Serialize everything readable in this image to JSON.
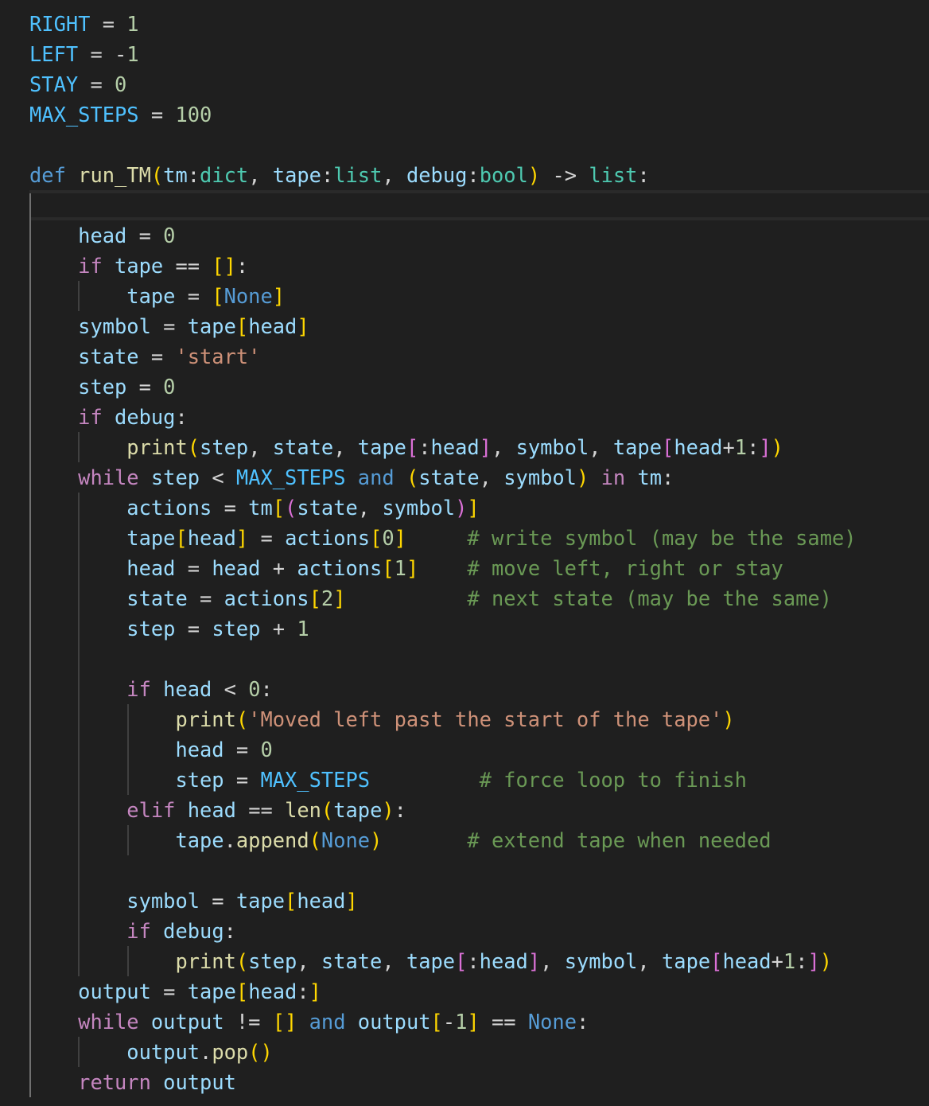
{
  "editor": {
    "language": "python",
    "theme_colors": {
      "background": "#1f1f1f",
      "keyword_control": "#c586c0",
      "keyword": "#569cd6",
      "constant": "#4fc1ff",
      "variable": "#9cdcfe",
      "function": "#dcdcaa",
      "type": "#4ec9b0",
      "number": "#b5cea8",
      "string": "#ce9178",
      "comment": "#6a9955",
      "bracket_level_1": "#ffd700",
      "bracket_level_2": "#da70d6"
    },
    "current_line": 6,
    "lines": [
      {
        "indent": 0,
        "tokens": [
          [
            "const",
            "RIGHT"
          ],
          [
            "op",
            " = "
          ],
          [
            "num",
            "1"
          ]
        ]
      },
      {
        "indent": 0,
        "tokens": [
          [
            "const",
            "LEFT"
          ],
          [
            "op",
            " = -"
          ],
          [
            "num",
            "1"
          ]
        ]
      },
      {
        "indent": 0,
        "tokens": [
          [
            "const",
            "STAY"
          ],
          [
            "op",
            " = "
          ],
          [
            "num",
            "0"
          ]
        ]
      },
      {
        "indent": 0,
        "tokens": [
          [
            "const",
            "MAX_STEPS"
          ],
          [
            "op",
            " = "
          ],
          [
            "num",
            "100"
          ]
        ]
      },
      {
        "indent": 0,
        "tokens": []
      },
      {
        "indent": 0,
        "tokens": [
          [
            "kw",
            "def"
          ],
          [
            "op",
            " "
          ],
          [
            "fn",
            "run_TM"
          ],
          [
            "b1",
            "("
          ],
          [
            "var",
            "tm"
          ],
          [
            "op",
            ":"
          ],
          [
            "type",
            "dict"
          ],
          [
            "op",
            ", "
          ],
          [
            "var",
            "tape"
          ],
          [
            "op",
            ":"
          ],
          [
            "type",
            "list"
          ],
          [
            "op",
            ", "
          ],
          [
            "var",
            "debug"
          ],
          [
            "op",
            ":"
          ],
          [
            "type",
            "bool"
          ],
          [
            "b1",
            ")"
          ],
          [
            "op",
            " -> "
          ],
          [
            "type",
            "list"
          ],
          [
            "op",
            ":"
          ]
        ]
      },
      {
        "indent": 1,
        "tokens": [],
        "current": true
      },
      {
        "indent": 1,
        "tokens": [
          [
            "var",
            "head"
          ],
          [
            "op",
            " = "
          ],
          [
            "num",
            "0"
          ]
        ]
      },
      {
        "indent": 1,
        "tokens": [
          [
            "kw-ctrl",
            "if"
          ],
          [
            "op",
            " "
          ],
          [
            "var",
            "tape"
          ],
          [
            "op",
            " == "
          ],
          [
            "b1",
            "[]"
          ],
          [
            "op",
            ":"
          ]
        ]
      },
      {
        "indent": 2,
        "tokens": [
          [
            "var",
            "tape"
          ],
          [
            "op",
            " = "
          ],
          [
            "b1",
            "["
          ],
          [
            "kw",
            "None"
          ],
          [
            "b1",
            "]"
          ]
        ]
      },
      {
        "indent": 1,
        "tokens": [
          [
            "var",
            "symbol"
          ],
          [
            "op",
            " = "
          ],
          [
            "var",
            "tape"
          ],
          [
            "b1",
            "["
          ],
          [
            "var",
            "head"
          ],
          [
            "b1",
            "]"
          ]
        ]
      },
      {
        "indent": 1,
        "tokens": [
          [
            "var",
            "state"
          ],
          [
            "op",
            " = "
          ],
          [
            "str",
            "'start'"
          ]
        ]
      },
      {
        "indent": 1,
        "tokens": [
          [
            "var",
            "step"
          ],
          [
            "op",
            " = "
          ],
          [
            "num",
            "0"
          ]
        ]
      },
      {
        "indent": 1,
        "tokens": [
          [
            "kw-ctrl",
            "if"
          ],
          [
            "op",
            " "
          ],
          [
            "var",
            "debug"
          ],
          [
            "op",
            ":"
          ]
        ]
      },
      {
        "indent": 2,
        "tokens": [
          [
            "fn",
            "print"
          ],
          [
            "b1",
            "("
          ],
          [
            "var",
            "step"
          ],
          [
            "op",
            ", "
          ],
          [
            "var",
            "state"
          ],
          [
            "op",
            ", "
          ],
          [
            "var",
            "tape"
          ],
          [
            "b2",
            "["
          ],
          [
            "op",
            ":"
          ],
          [
            "var",
            "head"
          ],
          [
            "b2",
            "]"
          ],
          [
            "op",
            ", "
          ],
          [
            "var",
            "symbol"
          ],
          [
            "op",
            ", "
          ],
          [
            "var",
            "tape"
          ],
          [
            "b2",
            "["
          ],
          [
            "var",
            "head"
          ],
          [
            "op",
            "+"
          ],
          [
            "num",
            "1"
          ],
          [
            "op",
            ":"
          ],
          [
            "b2",
            "]"
          ],
          [
            "b1",
            ")"
          ]
        ]
      },
      {
        "indent": 1,
        "tokens": [
          [
            "kw-ctrl",
            "while"
          ],
          [
            "op",
            " "
          ],
          [
            "var",
            "step"
          ],
          [
            "op",
            " < "
          ],
          [
            "const",
            "MAX_STEPS"
          ],
          [
            "op",
            " "
          ],
          [
            "kw",
            "and"
          ],
          [
            "op",
            " "
          ],
          [
            "b1",
            "("
          ],
          [
            "var",
            "state"
          ],
          [
            "op",
            ", "
          ],
          [
            "var",
            "symbol"
          ],
          [
            "b1",
            ")"
          ],
          [
            "op",
            " "
          ],
          [
            "kw-ctrl",
            "in"
          ],
          [
            "op",
            " "
          ],
          [
            "var",
            "tm"
          ],
          [
            "op",
            ":"
          ]
        ]
      },
      {
        "indent": 2,
        "tokens": [
          [
            "var",
            "actions"
          ],
          [
            "op",
            " = "
          ],
          [
            "var",
            "tm"
          ],
          [
            "b1",
            "["
          ],
          [
            "b2",
            "("
          ],
          [
            "var",
            "state"
          ],
          [
            "op",
            ", "
          ],
          [
            "var",
            "symbol"
          ],
          [
            "b2",
            ")"
          ],
          [
            "b1",
            "]"
          ]
        ]
      },
      {
        "indent": 2,
        "tokens": [
          [
            "var",
            "tape"
          ],
          [
            "b1",
            "["
          ],
          [
            "var",
            "head"
          ],
          [
            "b1",
            "]"
          ],
          [
            "op",
            " = "
          ],
          [
            "var",
            "actions"
          ],
          [
            "b1",
            "["
          ],
          [
            "num",
            "0"
          ],
          [
            "b1",
            "]"
          ],
          [
            "op",
            "     "
          ],
          [
            "cmt",
            "# write symbol (may be the same)"
          ]
        ]
      },
      {
        "indent": 2,
        "tokens": [
          [
            "var",
            "head"
          ],
          [
            "op",
            " = "
          ],
          [
            "var",
            "head"
          ],
          [
            "op",
            " + "
          ],
          [
            "var",
            "actions"
          ],
          [
            "b1",
            "["
          ],
          [
            "num",
            "1"
          ],
          [
            "b1",
            "]"
          ],
          [
            "op",
            "    "
          ],
          [
            "cmt",
            "# move left, right or stay"
          ]
        ]
      },
      {
        "indent": 2,
        "tokens": [
          [
            "var",
            "state"
          ],
          [
            "op",
            " = "
          ],
          [
            "var",
            "actions"
          ],
          [
            "b1",
            "["
          ],
          [
            "num",
            "2"
          ],
          [
            "b1",
            "]"
          ],
          [
            "op",
            "          "
          ],
          [
            "cmt",
            "# next state (may be the same)"
          ]
        ]
      },
      {
        "indent": 2,
        "tokens": [
          [
            "var",
            "step"
          ],
          [
            "op",
            " = "
          ],
          [
            "var",
            "step"
          ],
          [
            "op",
            " + "
          ],
          [
            "num",
            "1"
          ]
        ]
      },
      {
        "indent": 2,
        "tokens": []
      },
      {
        "indent": 2,
        "tokens": [
          [
            "kw-ctrl",
            "if"
          ],
          [
            "op",
            " "
          ],
          [
            "var",
            "head"
          ],
          [
            "op",
            " < "
          ],
          [
            "num",
            "0"
          ],
          [
            "op",
            ":"
          ]
        ]
      },
      {
        "indent": 3,
        "tokens": [
          [
            "fn",
            "print"
          ],
          [
            "b1",
            "("
          ],
          [
            "str",
            "'Moved left past the start of the tape'"
          ],
          [
            "b1",
            ")"
          ]
        ]
      },
      {
        "indent": 3,
        "tokens": [
          [
            "var",
            "head"
          ],
          [
            "op",
            " = "
          ],
          [
            "num",
            "0"
          ]
        ]
      },
      {
        "indent": 3,
        "tokens": [
          [
            "var",
            "step"
          ],
          [
            "op",
            " = "
          ],
          [
            "const",
            "MAX_STEPS"
          ],
          [
            "op",
            "         "
          ],
          [
            "cmt",
            "# force loop to finish"
          ]
        ]
      },
      {
        "indent": 2,
        "tokens": [
          [
            "kw-ctrl",
            "elif"
          ],
          [
            "op",
            " "
          ],
          [
            "var",
            "head"
          ],
          [
            "op",
            " == "
          ],
          [
            "fn",
            "len"
          ],
          [
            "b1",
            "("
          ],
          [
            "var",
            "tape"
          ],
          [
            "b1",
            ")"
          ],
          [
            "op",
            ":"
          ]
        ]
      },
      {
        "indent": 3,
        "tokens": [
          [
            "var",
            "tape"
          ],
          [
            "op",
            "."
          ],
          [
            "fn",
            "append"
          ],
          [
            "b1",
            "("
          ],
          [
            "kw",
            "None"
          ],
          [
            "b1",
            ")"
          ],
          [
            "op",
            "       "
          ],
          [
            "cmt",
            "# extend tape when needed"
          ]
        ]
      },
      {
        "indent": 2,
        "tokens": []
      },
      {
        "indent": 2,
        "tokens": [
          [
            "var",
            "symbol"
          ],
          [
            "op",
            " = "
          ],
          [
            "var",
            "tape"
          ],
          [
            "b1",
            "["
          ],
          [
            "var",
            "head"
          ],
          [
            "b1",
            "]"
          ]
        ]
      },
      {
        "indent": 2,
        "tokens": [
          [
            "kw-ctrl",
            "if"
          ],
          [
            "op",
            " "
          ],
          [
            "var",
            "debug"
          ],
          [
            "op",
            ":"
          ]
        ]
      },
      {
        "indent": 3,
        "tokens": [
          [
            "fn",
            "print"
          ],
          [
            "b1",
            "("
          ],
          [
            "var",
            "step"
          ],
          [
            "op",
            ", "
          ],
          [
            "var",
            "state"
          ],
          [
            "op",
            ", "
          ],
          [
            "var",
            "tape"
          ],
          [
            "b2",
            "["
          ],
          [
            "op",
            ":"
          ],
          [
            "var",
            "head"
          ],
          [
            "b2",
            "]"
          ],
          [
            "op",
            ", "
          ],
          [
            "var",
            "symbol"
          ],
          [
            "op",
            ", "
          ],
          [
            "var",
            "tape"
          ],
          [
            "b2",
            "["
          ],
          [
            "var",
            "head"
          ],
          [
            "op",
            "+"
          ],
          [
            "num",
            "1"
          ],
          [
            "op",
            ":"
          ],
          [
            "b2",
            "]"
          ],
          [
            "b1",
            ")"
          ]
        ]
      },
      {
        "indent": 1,
        "tokens": [
          [
            "var",
            "output"
          ],
          [
            "op",
            " = "
          ],
          [
            "var",
            "tape"
          ],
          [
            "b1",
            "["
          ],
          [
            "var",
            "head"
          ],
          [
            "op",
            ":"
          ],
          [
            "b1",
            "]"
          ]
        ]
      },
      {
        "indent": 1,
        "tokens": [
          [
            "kw-ctrl",
            "while"
          ],
          [
            "op",
            " "
          ],
          [
            "var",
            "output"
          ],
          [
            "op",
            " != "
          ],
          [
            "b1",
            "[]"
          ],
          [
            "op",
            " "
          ],
          [
            "kw",
            "and"
          ],
          [
            "op",
            " "
          ],
          [
            "var",
            "output"
          ],
          [
            "b1",
            "["
          ],
          [
            "op",
            "-"
          ],
          [
            "num",
            "1"
          ],
          [
            "b1",
            "]"
          ],
          [
            "op",
            " == "
          ],
          [
            "kw",
            "None"
          ],
          [
            "op",
            ":"
          ]
        ]
      },
      {
        "indent": 2,
        "tokens": [
          [
            "var",
            "output"
          ],
          [
            "op",
            "."
          ],
          [
            "fn",
            "pop"
          ],
          [
            "b1",
            "()"
          ]
        ]
      },
      {
        "indent": 1,
        "tokens": [
          [
            "kw-ctrl",
            "return"
          ],
          [
            "op",
            " "
          ],
          [
            "var",
            "output"
          ]
        ]
      }
    ]
  }
}
